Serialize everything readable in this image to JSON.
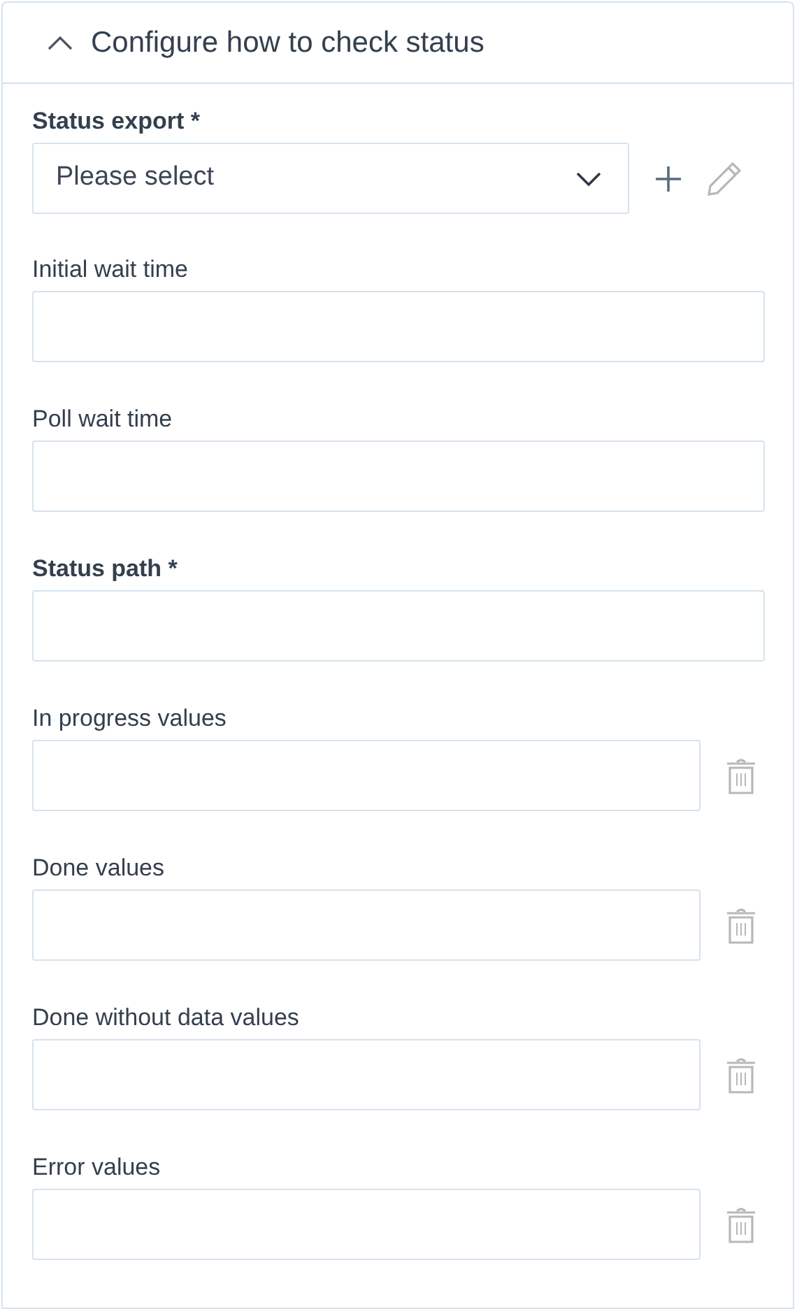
{
  "section": {
    "title": "Configure how to check status",
    "expanded": true
  },
  "fields": [
    {
      "kind": "select",
      "label": "Status export *",
      "required": true,
      "placeholder": "Please select"
    },
    {
      "kind": "text",
      "label": "Initial wait time",
      "required": false
    },
    {
      "kind": "text",
      "label": "Poll wait time",
      "required": false
    },
    {
      "kind": "text",
      "label": "Status path *",
      "required": true
    },
    {
      "kind": "list",
      "label": "In progress values",
      "required": false
    },
    {
      "kind": "list",
      "label": "Done values",
      "required": false
    },
    {
      "kind": "list",
      "label": "Done without data values",
      "required": false
    },
    {
      "kind": "list",
      "label": "Error values",
      "required": false
    }
  ]
}
